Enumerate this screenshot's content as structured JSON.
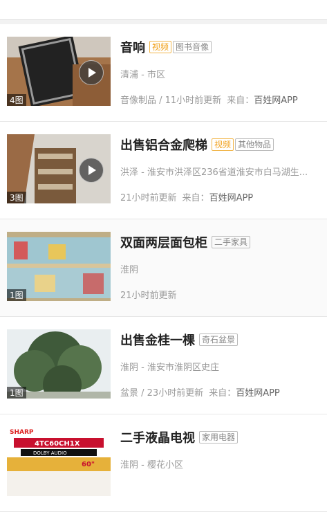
{
  "listing": [
    {
      "title": "音响",
      "tags": [
        "视频",
        "图书音像"
      ],
      "location": "清浦 - 市区",
      "meta": "音像制品 / 11小时前更新",
      "source_label": "来自：",
      "source_name": "百姓网APP",
      "image_count": "4图",
      "has_video": true
    },
    {
      "title": "出售铝合金爬梯",
      "tags": [
        "视频",
        "其他物品"
      ],
      "location": "洪泽 - 淮安市洪泽区236省道淮安市白马湖生...",
      "meta": "21小时前更新",
      "source_label": "来自：",
      "source_name": "百姓网APP",
      "image_count": "3图",
      "has_video": true
    },
    {
      "title": "双面两层面包柜",
      "tags": [
        "二手家具"
      ],
      "location": "淮阴",
      "meta": "21小时前更新",
      "source_label": "",
      "source_name": "",
      "image_count": "1图",
      "has_video": false
    },
    {
      "title": "出售金桂一棵",
      "tags": [
        "奇石盆景"
      ],
      "location": "淮阴 - 淮安市淮阴区史庄",
      "meta": "盆景 / 23小时前更新",
      "source_label": "来自：",
      "source_name": "百姓网APP",
      "image_count": "1图",
      "has_video": false
    },
    {
      "title": "二手液晶电视",
      "tags": [
        "家用电器"
      ],
      "location": "淮阴 - 樱花小区",
      "meta": "",
      "source_label": "",
      "source_name": "",
      "image_count": "",
      "has_video": false,
      "image_text": [
        "SHARP",
        "4TC60CH1X",
        "DOLBY AUDIO",
        "60\""
      ]
    }
  ]
}
